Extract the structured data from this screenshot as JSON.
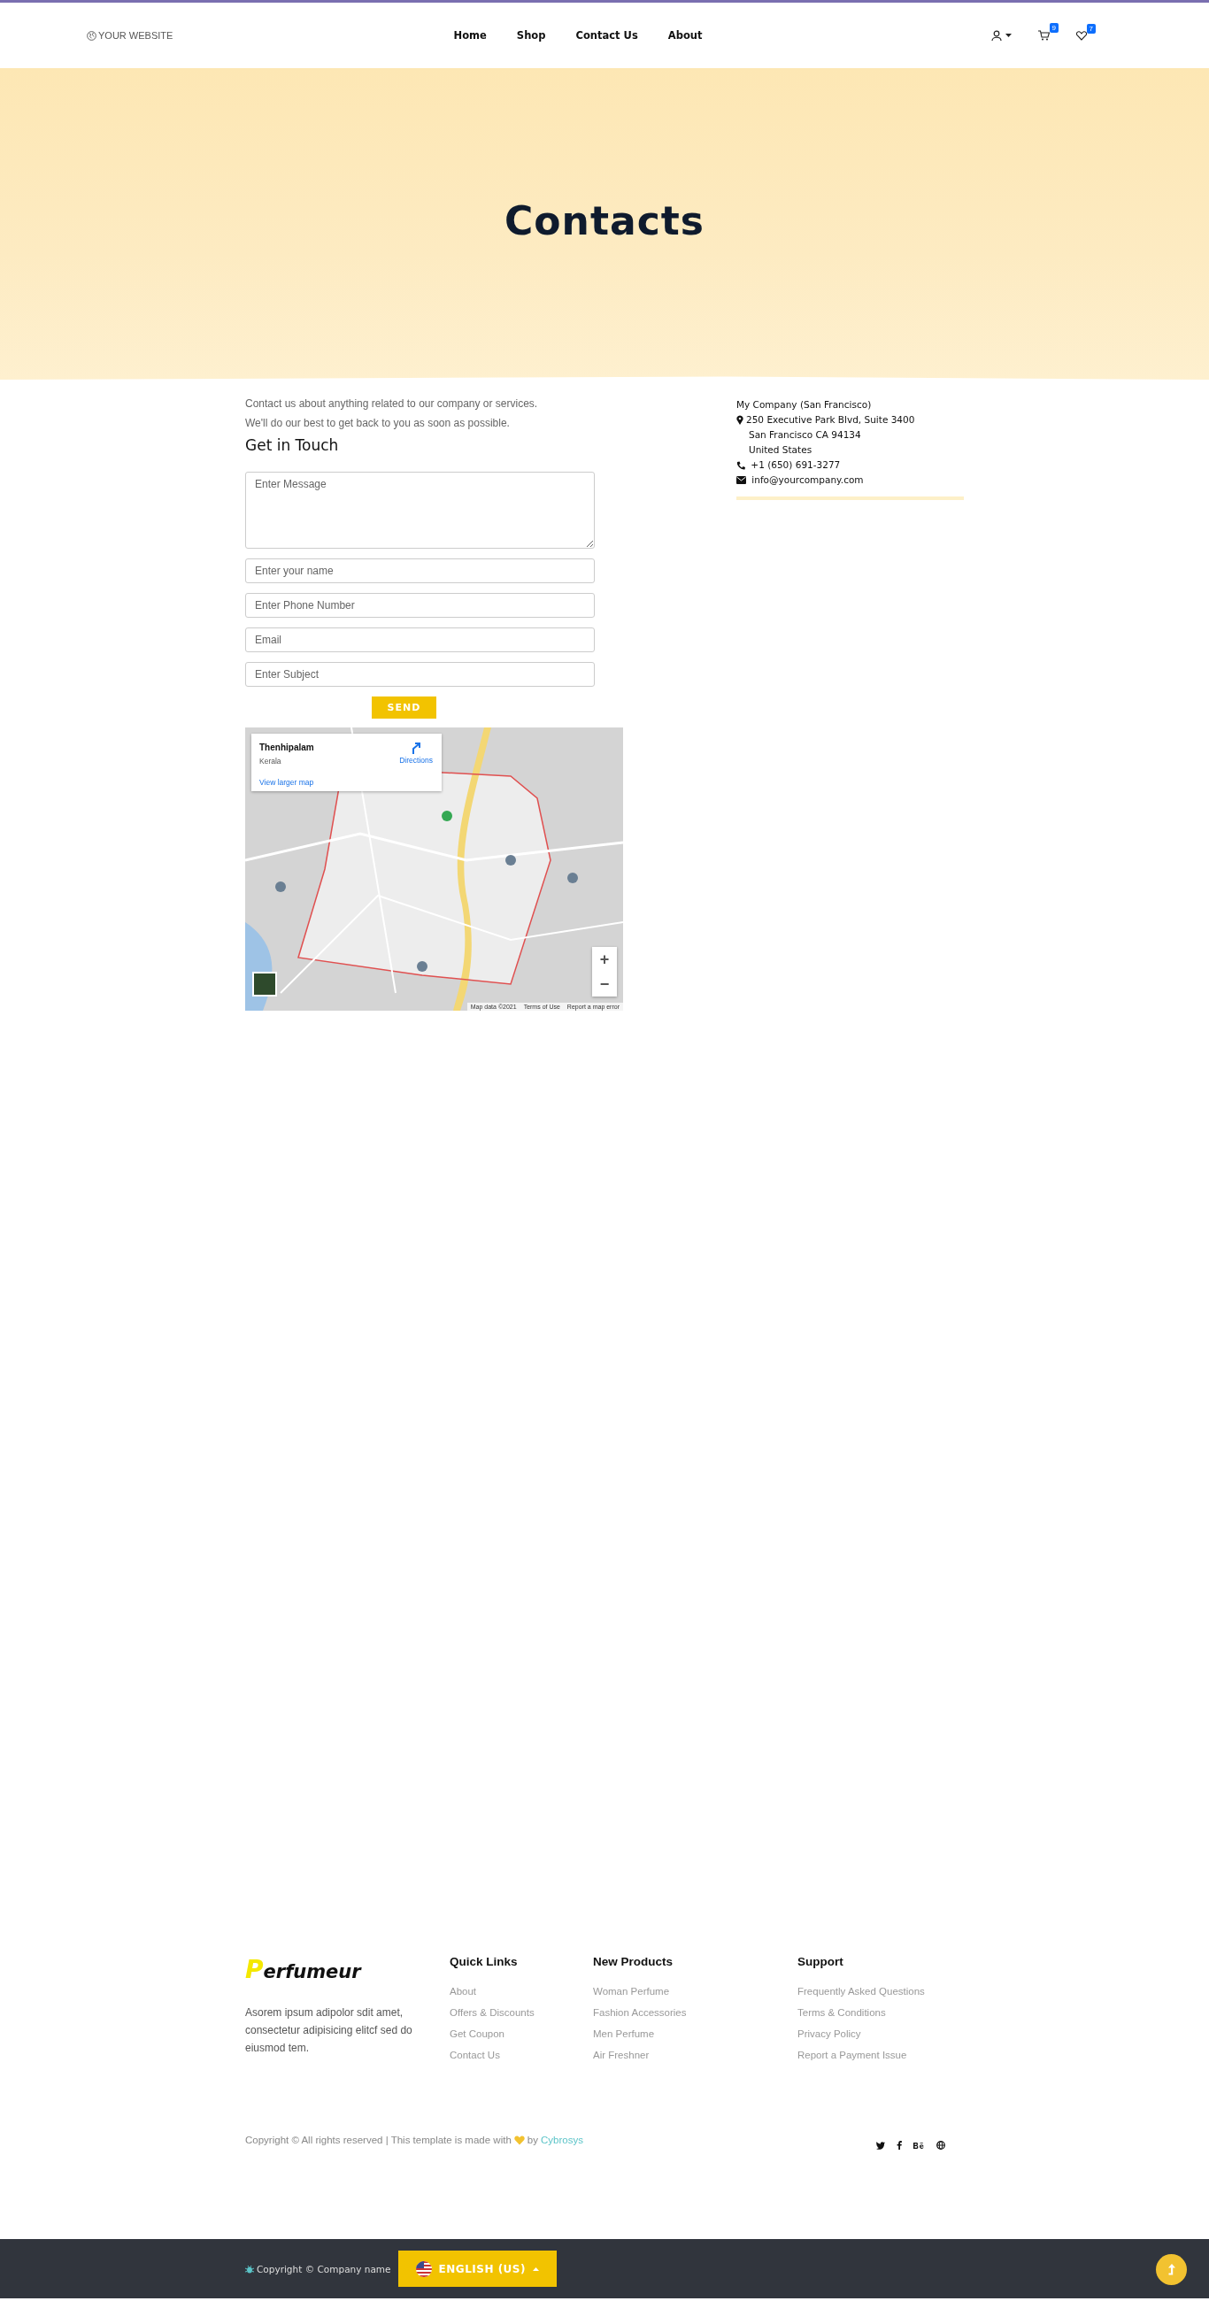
{
  "header": {
    "brand": "YOUR WEBSITE",
    "nav": [
      {
        "label": "Home"
      },
      {
        "label": "Shop"
      },
      {
        "label": "Contact Us"
      },
      {
        "label": "About"
      }
    ],
    "cart_count": "9",
    "wishlist_count": "7"
  },
  "hero": {
    "title": "Contacts"
  },
  "contact": {
    "intro": [
      "Contact us about anything related to our company or services.",
      "We'll do our best to get back to you as soon as possible."
    ],
    "heading": "Get in Touch",
    "fields": [
      {
        "kind": "textarea",
        "placeholder": "Enter Message"
      },
      {
        "kind": "input",
        "placeholder": "Enter your name"
      },
      {
        "kind": "input",
        "placeholder": "Enter Phone Number"
      },
      {
        "kind": "input",
        "placeholder": "Email"
      },
      {
        "kind": "input",
        "placeholder": "Enter Subject"
      }
    ],
    "send": "SEND"
  },
  "map": {
    "place": "Thenhipalam",
    "region": "Kerala",
    "directions": "Directions",
    "larger_map": "View larger map",
    "zoom_in": "+",
    "zoom_out": "−",
    "attribution": [
      "Map data ©2021",
      "Terms of Use",
      "Report a map error"
    ]
  },
  "company": {
    "name": "My Company (San Francisco)",
    "address": [
      "250 Executive Park Blvd, Suite 3400",
      "San Francisco CA 94134",
      "United States"
    ],
    "phone": "+1 (650) 691-3277",
    "email": "info@yourcompany.com"
  },
  "footer": {
    "logo": "Perfumeur",
    "about": "Asorem ipsum adipolor sdit amet, consectetur adipisicing elitcf sed do eiusmod tem.",
    "columns": [
      {
        "title": "Quick Links",
        "links": [
          "About",
          "Offers & Discounts",
          "Get Coupon",
          "Contact Us"
        ]
      },
      {
        "title": "New Products",
        "links": [
          "Woman Perfume",
          "Fashion Accessories",
          "Men Perfume",
          "Air Freshner"
        ]
      },
      {
        "title": "Support",
        "links": [
          "Frequently Asked Questions",
          "Terms & Conditions",
          "Privacy Policy",
          "Report a Payment Issue"
        ]
      }
    ],
    "copyright": "Copyright © All rights reserved | This template is made with",
    "by": "by",
    "author": "Cybrosys"
  },
  "bottom_bar": {
    "copyright": "Copyright © Company name",
    "language": "ENGLISH (US)"
  }
}
